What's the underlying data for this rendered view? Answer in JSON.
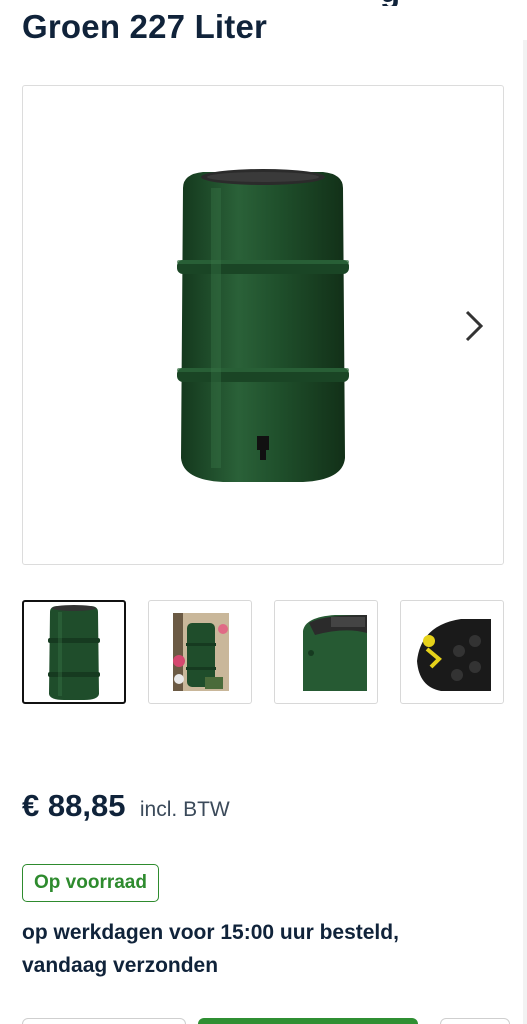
{
  "product": {
    "title_line": "Groen 227 Liter",
    "title_cut_glyph": "g"
  },
  "gallery": {
    "main_image": "green-rain-barrel",
    "next_icon": "chevron-right-icon",
    "thumbnails": [
      {
        "name": "thumb-barrel-front",
        "active": true
      },
      {
        "name": "thumb-barrel-garden",
        "active": false
      },
      {
        "name": "thumb-barrel-lid-detail",
        "active": false
      },
      {
        "name": "thumb-barrel-interior-detail",
        "active": false
      }
    ]
  },
  "pricing": {
    "price": "€ 88,85",
    "note": "incl. BTW"
  },
  "stock": {
    "badge": "Op voorraad",
    "delivery_line1": "op werkdagen voor 15:00 uur besteld,",
    "delivery_line2": "vandaag verzonden"
  },
  "colors": {
    "barrel": "#1f4d2b",
    "barrel_dark": "#163a20",
    "stock_green": "#2e8b2e",
    "cart_green": "#2f8f33",
    "text_dark": "#10233a"
  }
}
